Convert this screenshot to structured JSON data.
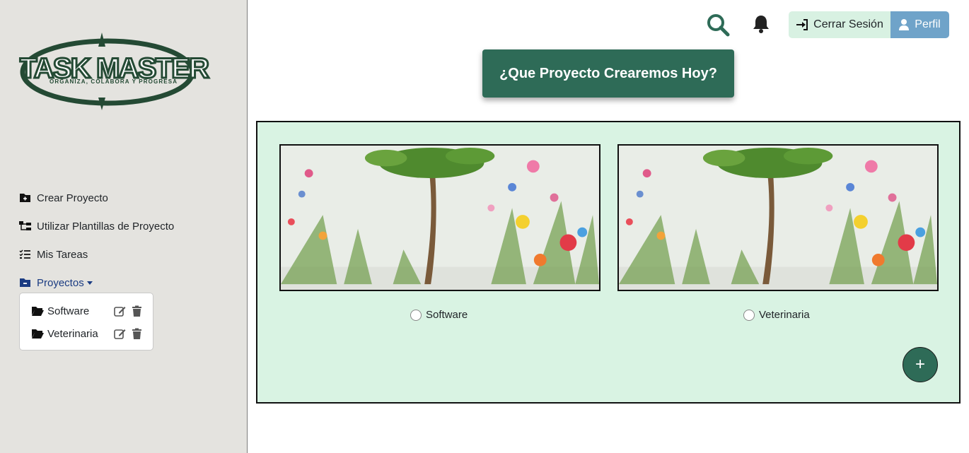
{
  "app": {
    "logo_title": "TASK MASTER",
    "logo_tagline": "ORGANIZA, COLABORA Y PROGRESA"
  },
  "sidebar": {
    "items": [
      {
        "label": "Crear Proyecto",
        "icon": "folder-plus-icon"
      },
      {
        "label": "Utilizar Plantillas de Proyecto",
        "icon": "sitemap-icon"
      },
      {
        "label": "Mis Tareas",
        "icon": "list-check-icon"
      },
      {
        "label": "Proyectos",
        "icon": "folder-minus-icon"
      }
    ],
    "projects": [
      {
        "name": "Software"
      },
      {
        "name": "Veterinaria"
      }
    ]
  },
  "header": {
    "logout_label": "Cerrar Sesión",
    "profile_label": "Perfil"
  },
  "main": {
    "hero_title": "¿Que Proyecto Crearemos Hoy?",
    "cards": [
      {
        "label": "Software"
      },
      {
        "label": "Veterinaria"
      }
    ],
    "fab_label": "+"
  },
  "colors": {
    "accent": "#2e6b57",
    "panel_bg": "#d9f3e3",
    "sidebar_bg": "#e4e3df",
    "profile_btn": "#6fa3c9",
    "active_nav": "#1a3b82"
  }
}
